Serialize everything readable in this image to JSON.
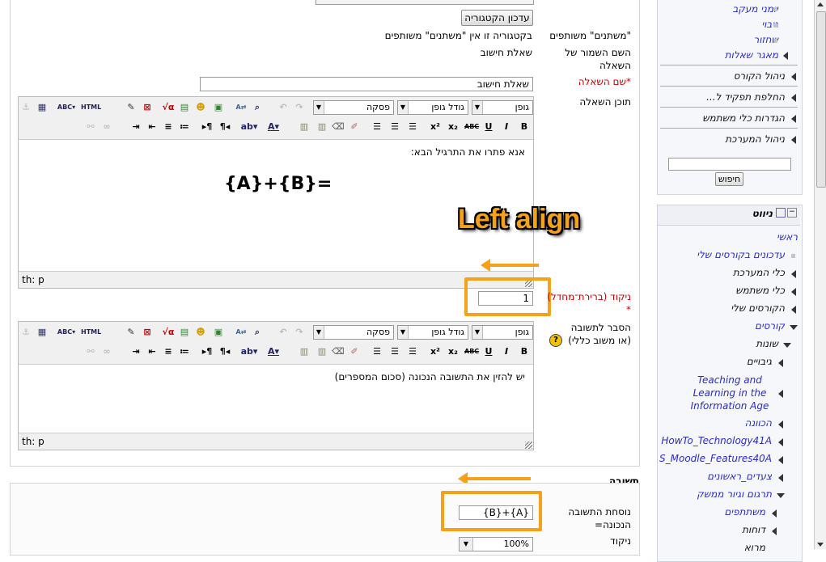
{
  "form": {
    "update_category_button": "עדכון הקטגוריה",
    "shared_vars_label": "\"משתנים\" משותפים",
    "shared_vars_value": "בקטגוריה זו אין \"משתנים\" משותפים",
    "saved_name_label": "השם השמור של השאלה",
    "saved_name_value": "שאלת חישוב",
    "question_name_label": "שם השאלה",
    "question_name_value": "שאלת חישוב",
    "question_text_label": "תוכן השאלה",
    "grade_label": "ניקוד (ברירת־מחדל)",
    "grade_value": "1",
    "feedback_label": "הסבר לתשובה (או משוב כללי)",
    "answer_section_title": "תשובה",
    "answer_formula_label": "נוסחת התשובה הנכונה=",
    "answer_formula_value": "{A}+{B}",
    "answer_grade_label": "ניקוד",
    "answer_grade_value": "100%"
  },
  "editor": {
    "font_select": "גופן",
    "size_select": "גודל גופן",
    "format_select": "פסקה",
    "path_text": "th: p",
    "question_body_line1": "אנא פתרו את התרגיל הבא:",
    "question_body_formula": "{A}+{B}=",
    "feedback_body_line1": "יש להזין את התשובה הנכונה (סכום המספרים)"
  },
  "annotation": {
    "callout_text": "Left align"
  },
  "sidebar": {
    "admin_items": [
      {
        "label": "יומני מעקב"
      },
      {
        "label": "גיבוי"
      },
      {
        "label": "שחזור"
      },
      {
        "label": "מאגר שאלות"
      },
      {
        "label": "ניהול הקורס"
      },
      {
        "label": "החלפת תפקיד ל..."
      },
      {
        "label": "הגדרות כלי משתמש"
      },
      {
        "label": "ניהול המערכת"
      }
    ],
    "search_button": "חיפוש",
    "nav_title": "ניווט",
    "nav_items": [
      {
        "label": "ראשי"
      },
      {
        "label": "עדכונים בקורסים שלי"
      },
      {
        "label": "כלי המערכת"
      },
      {
        "label": "כלי משתמש"
      },
      {
        "label": "הקורסים שלי"
      },
      {
        "label": "קורסים"
      },
      {
        "label": "שונות"
      },
      {
        "label": "גיבויים"
      },
      {
        "label": "Teaching and Learning in the Information Age"
      },
      {
        "label": "הכוונה"
      },
      {
        "label": "HowTo_Technology41A"
      },
      {
        "label": "S_Moodle_Features40A"
      },
      {
        "label": "צעדים_ראשונים"
      },
      {
        "label": "תרגום וגיור ממשק"
      },
      {
        "label": "משתתפים"
      },
      {
        "label": "דוחות"
      },
      {
        "label": "מרוא"
      }
    ]
  },
  "colors": {
    "accent": "#f5a21a",
    "link": "#2a2acc",
    "required": "#cc0000"
  }
}
